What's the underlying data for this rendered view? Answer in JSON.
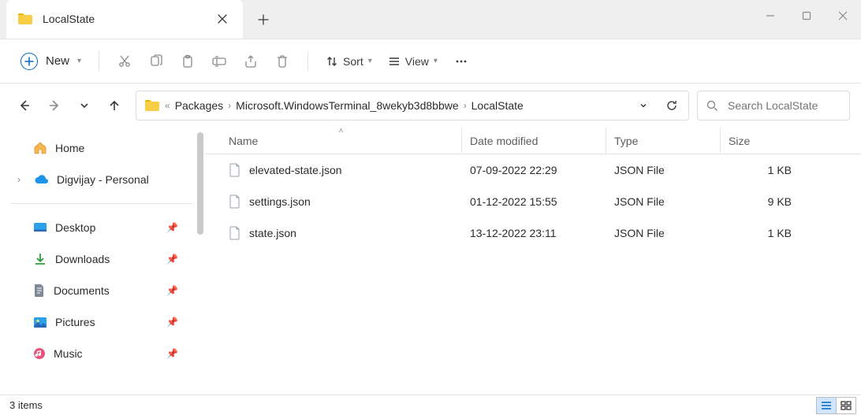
{
  "tab": {
    "title": "LocalState"
  },
  "toolbar": {
    "new_label": "New",
    "sort_label": "Sort",
    "view_label": "View"
  },
  "breadcrumb": {
    "parts": [
      "Packages",
      "Microsoft.WindowsTerminal_8wekyb3d8bbwe",
      "LocalState"
    ]
  },
  "search": {
    "placeholder": "Search LocalState"
  },
  "navpane": {
    "home": "Home",
    "onedrive": "Digvijay - Personal",
    "quick": [
      "Desktop",
      "Downloads",
      "Documents",
      "Pictures",
      "Music"
    ]
  },
  "columns": {
    "name": "Name",
    "date": "Date modified",
    "type": "Type",
    "size": "Size"
  },
  "files": [
    {
      "name": "elevated-state.json",
      "date": "07-09-2022 22:29",
      "type": "JSON File",
      "size": "1 KB"
    },
    {
      "name": "settings.json",
      "date": "01-12-2022 15:55",
      "type": "JSON File",
      "size": "9 KB"
    },
    {
      "name": "state.json",
      "date": "13-12-2022 23:11",
      "type": "JSON File",
      "size": "1 KB"
    }
  ],
  "status": {
    "text": "3 items"
  }
}
